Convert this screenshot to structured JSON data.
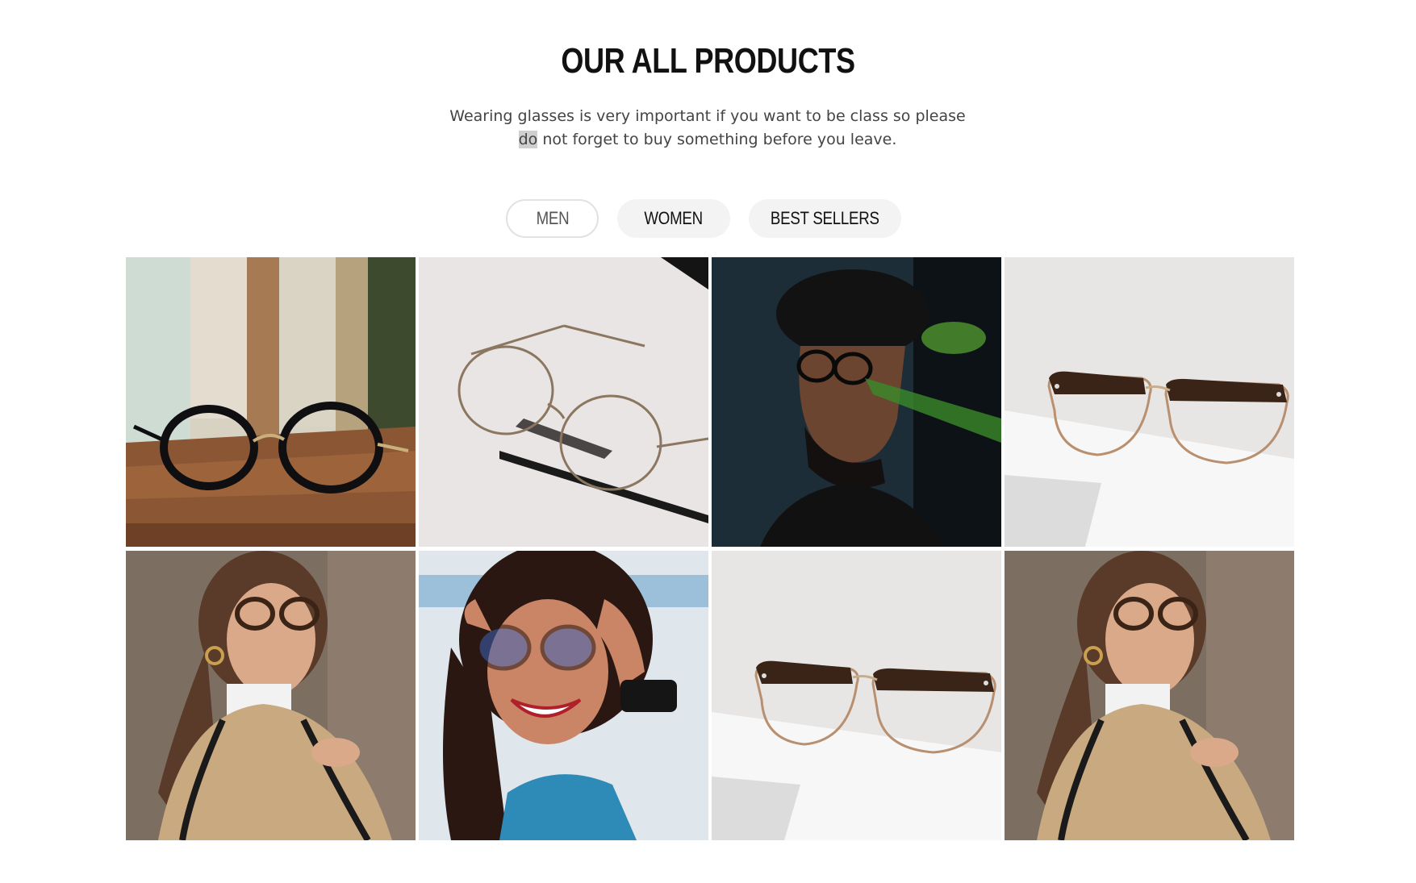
{
  "section": {
    "title": "OUR ALL PRODUCTS",
    "subtitle_part1": "Wearing glasses is very important if you want to be class so please",
    "subtitle_highlight": "do",
    "subtitle_part2": " not forget to buy something before you leave."
  },
  "filters": [
    {
      "label": "MEN",
      "active": true
    },
    {
      "label": "WOMEN",
      "active": false
    },
    {
      "label": "BEST SELLERS",
      "active": false
    }
  ],
  "products": [
    {
      "depicts": "round-black-glasses-on-wood"
    },
    {
      "depicts": "gold-wire-glasses-on-paper"
    },
    {
      "depicts": "man-with-hat-and-glasses"
    },
    {
      "depicts": "tortoiseshell-browline-glasses"
    },
    {
      "depicts": "woman-with-tortoise-glasses"
    },
    {
      "depicts": "smiling-woman-adjusting-glasses"
    },
    {
      "depicts": "tortoiseshell-browline-glasses"
    },
    {
      "depicts": "woman-with-tortoise-glasses"
    }
  ],
  "colors": {
    "text": "#111111",
    "subtext": "#444444",
    "pill_bg": "#f3f3f3",
    "pill_border": "#e2e2e2"
  }
}
